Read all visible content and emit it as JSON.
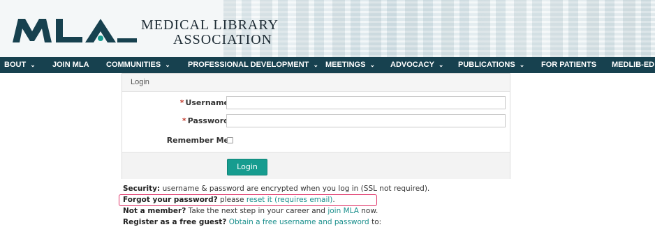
{
  "header": {
    "logo_mark": "MLA",
    "logo_line1": "Medical Library",
    "logo_line2": "Association"
  },
  "nav": {
    "items": [
      {
        "label": "BOUT",
        "caret": "⌄"
      },
      {
        "label": "JOIN MLA",
        "caret": ""
      },
      {
        "label": "COMMUNITIES",
        "caret": "⌄"
      },
      {
        "label": "PROFESSIONAL DEVELOPMENT",
        "caret": "⌄"
      },
      {
        "label": "MEETINGS",
        "caret": "⌄"
      },
      {
        "label": "ADVOCACY",
        "caret": "⌄"
      },
      {
        "label": "PUBLICATIONS",
        "caret": "⌄"
      },
      {
        "label": "FOR PATIENTS",
        "caret": ""
      },
      {
        "label": "MEDLIB-ED",
        "caret": ""
      }
    ]
  },
  "login": {
    "title": "Login",
    "required_mark": "*",
    "username_label": "Username",
    "username_value": "",
    "password_label": "Password",
    "password_value": "",
    "remember_label": "Remember Me",
    "submit_label": "Login"
  },
  "info": {
    "security_bold": "Security:",
    "security_text": " username & password are encrypted when you log in (SSL not required).",
    "forgot_bold": "Forgot your password?",
    "forgot_text": " please ",
    "forgot_link": "reset it (requires email)",
    "forgot_end": ".",
    "member_bold": "Not a member?",
    "member_text": " Take the next step in your career and ",
    "member_link": "join MLA",
    "member_end": " now.",
    "guest_bold": "Register as a free guest?",
    "guest_text": " ",
    "guest_link": "Obtain a free username and password",
    "guest_end": " to:"
  },
  "colors": {
    "nav_bg": "#17414f",
    "accent": "#169c8f",
    "link": "#1a8f8c",
    "highlight": "#e0366a"
  }
}
